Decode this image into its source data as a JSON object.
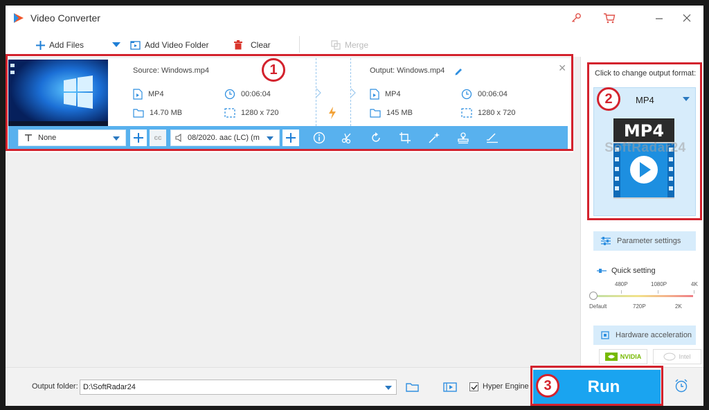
{
  "window": {
    "title": "Video Converter",
    "icons": [
      "key-icon",
      "cart-icon",
      "minimize-icon",
      "close-icon"
    ]
  },
  "toolbar": {
    "add_files": "Add Files",
    "add_video_folder": "Add Video Folder",
    "clear": "Clear",
    "merge": "Merge"
  },
  "file": {
    "source_label": "Source: Windows.mp4",
    "output_label": "Output: Windows.mp4",
    "source": {
      "format": "MP4",
      "duration": "00:06:04",
      "size": "14.70 MB",
      "resolution": "1280 x 720"
    },
    "output": {
      "format": "MP4",
      "duration": "00:06:04",
      "size": "145 MB",
      "resolution": "1280 x 720"
    },
    "subtitle_select": "None",
    "audio_select": "08/2020. aac (LC) (m",
    "tools": [
      "info-icon",
      "scissors-icon",
      "rotate-icon",
      "crop-icon",
      "effects-wand-icon",
      "watermark-stamp-icon",
      "subtitle-edit-icon"
    ]
  },
  "right_panel": {
    "title": "Click to change output format:",
    "format_name": "MP4",
    "format_icon_text": "MP4",
    "watermark": "SoftRadar24",
    "parameter_settings": "Parameter settings",
    "quick_setting": "Quick setting",
    "quality_top": [
      "480P",
      "1080P",
      "4K"
    ],
    "quality_bottom": [
      "Default",
      "720P",
      "2K"
    ],
    "quality_selected": "Default",
    "hardware_acceleration": "Hardware acceleration",
    "nvidia": "NVIDIA",
    "intel": "Intel"
  },
  "bottom": {
    "output_folder_label": "Output folder:",
    "output_folder_value": "D:\\SoftRadar24",
    "hyper_engine_label": "Hyper Engine",
    "hyper_engine_checked": true,
    "run_label": "Run"
  },
  "annotations": {
    "one": "1",
    "two": "2",
    "three": "3"
  },
  "colors": {
    "accent": "#1aa4f0",
    "bar_blue": "#58b1ee",
    "annotation_red": "#d3222d",
    "clear_red": "#d9342b",
    "lightning_orange": "#f2a33a"
  }
}
